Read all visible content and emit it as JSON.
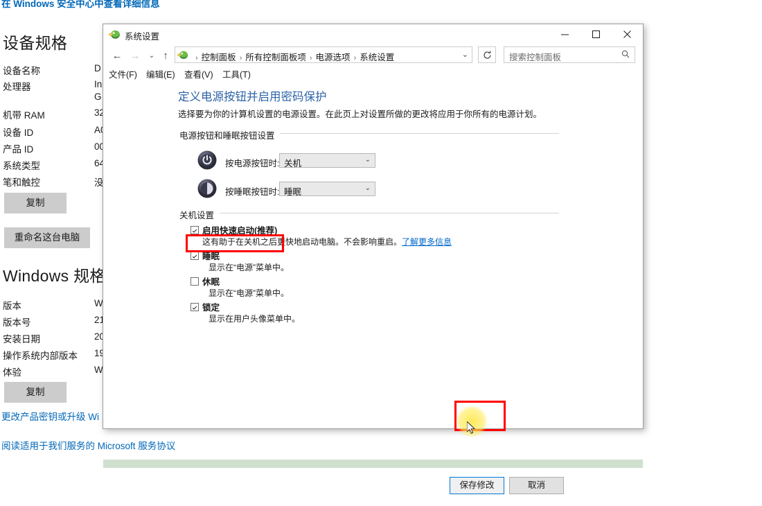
{
  "background": {
    "security_link": "在 Windows 安全中心中查看详细信息",
    "device_spec_title": "设备规格",
    "device_specs": [
      {
        "key": "设备名称",
        "value": "D"
      },
      {
        "key": "处理器",
        "value": "In"
      },
      {
        "key": "",
        "value": "G"
      },
      {
        "key": "机带 RAM",
        "value": "32"
      },
      {
        "key": "设备 ID",
        "value": "A0"
      },
      {
        "key": "产品 ID",
        "value": "00"
      },
      {
        "key": "系统类型",
        "value": "64"
      },
      {
        "key": "笔和触控",
        "value": "没"
      }
    ],
    "copy_button_1": "复制",
    "rename_button": "重命名这台电脑",
    "windows_spec_title": "Windows 规格",
    "windows_specs": [
      {
        "key": "版本",
        "value": "W"
      },
      {
        "key": "版本号",
        "value": "21"
      },
      {
        "key": "安装日期",
        "value": "20"
      },
      {
        "key": "操作系统内部版本",
        "value": "19"
      },
      {
        "key": "体验",
        "value": "W"
      }
    ],
    "copy_button_2": "复制",
    "product_key_link": "更改产品密钥或升级 Wi",
    "msa_link": "阅读适用于我们服务的 Microsoft 服务协议"
  },
  "dialog": {
    "title": "系统设置",
    "window_buttons": {
      "minimize": "minimize-icon",
      "maximize": "maximize-icon",
      "close": "close-icon"
    },
    "nav": {
      "back": "back-arrow-icon",
      "forward": "forward-arrow-icon",
      "recent": "chevron-down-icon",
      "up": "up-arrow-icon",
      "refresh": "refresh-icon"
    },
    "breadcrumbs": [
      "控制面板",
      "所有控制面板项",
      "电源选项",
      "系统设置"
    ],
    "search": {
      "placeholder": "搜索控制面板",
      "icon": "search-icon"
    },
    "menus": [
      "文件(F)",
      "编辑(E)",
      "查看(V)",
      "工具(T)"
    ],
    "page_heading": "定义电源按钮并启用密码保护",
    "page_description": "选择要为你的计算机设置的电源设置。在此页上对设置所做的更改将应用于你所有的电源计划。",
    "group_power_buttons": {
      "label": "电源按钮和睡眠按钮设置",
      "rows": [
        {
          "icon": "power-icon",
          "label": "按电源按钮时:",
          "value": "关机"
        },
        {
          "icon": "sleep-icon",
          "label": "按睡眠按钮时:",
          "value": "睡眠"
        }
      ]
    },
    "group_shutdown": {
      "label": "关机设置",
      "items": [
        {
          "checked": true,
          "label": "启用快速启动(推荐)",
          "desc": "这有助于在关机之后更快地启动电脑。不会影响重启。",
          "link": "了解更多信息"
        },
        {
          "checked": true,
          "label": "睡眠",
          "desc": "显示在“电源”菜单中。",
          "link": ""
        },
        {
          "checked": false,
          "label": "休眠",
          "desc": "显示在“电源”菜单中。",
          "link": ""
        },
        {
          "checked": true,
          "label": "锁定",
          "desc": "显示在用户头像菜单中。",
          "link": ""
        }
      ]
    },
    "footer": {
      "save_label": "保存修改",
      "cancel_label": "取消"
    }
  },
  "annotations": {
    "highlight_color": "#ff0000",
    "cursor_highlight_color": "#ffe63c",
    "boxes": [
      "启用快速启动(推荐)",
      "保存修改"
    ]
  },
  "colors": {
    "link": "#0067b8",
    "heading": "#2d64a8",
    "green_band": "#cfe0cf",
    "focus_border": "#0078d7"
  }
}
